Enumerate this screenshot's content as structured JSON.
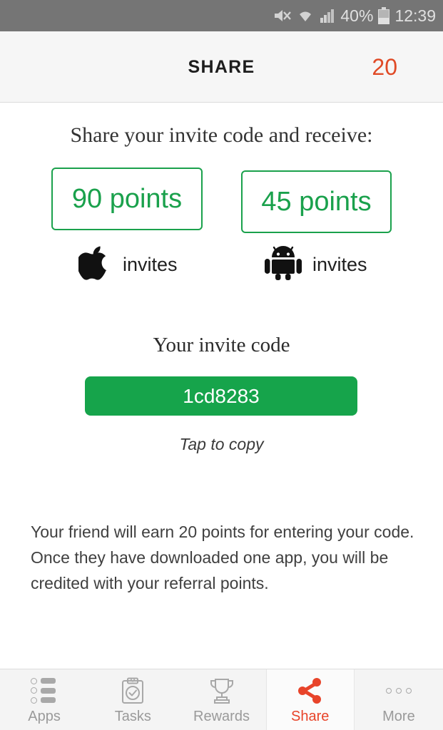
{
  "status_bar": {
    "mute_icon": "mute-icon",
    "wifi_icon": "wifi-icon",
    "signal_icon": "signal-icon",
    "battery_percent": "40%",
    "battery_icon": "battery-icon",
    "time": "12:39"
  },
  "header": {
    "title": "SHARE",
    "points": "20"
  },
  "main": {
    "share_heading": "Share your invite code and receive:",
    "offers": [
      {
        "points": "90 points",
        "platform_label": "invites",
        "platform_icon": "apple-icon"
      },
      {
        "points": "45 points",
        "platform_label": "invites",
        "platform_icon": "android-icon"
      }
    ],
    "invite_code_title": "Your invite code",
    "invite_code": "1cd8283",
    "tap_to_copy": "Tap to copy",
    "footer_note": "Your friend will earn 20 points for entering your code. Once they have downloaded one app, you will be credited with your referral points."
  },
  "bottom_nav": {
    "items": [
      {
        "label": "Apps",
        "icon": "apps-list-icon",
        "active": false
      },
      {
        "label": "Tasks",
        "icon": "clipboard-check-icon",
        "active": false
      },
      {
        "label": "Rewards",
        "icon": "trophy-icon",
        "active": false
      },
      {
        "label": "Share",
        "icon": "share-icon",
        "active": true
      },
      {
        "label": "More",
        "icon": "more-dots-icon",
        "active": false
      }
    ]
  },
  "colors": {
    "green": "#16a44b",
    "green_border": "#1aa14c",
    "accent_red": "#e8442a",
    "header_bg": "#f6f6f6",
    "status_bg": "#757575",
    "nav_inactive": "#9a9a9a"
  }
}
